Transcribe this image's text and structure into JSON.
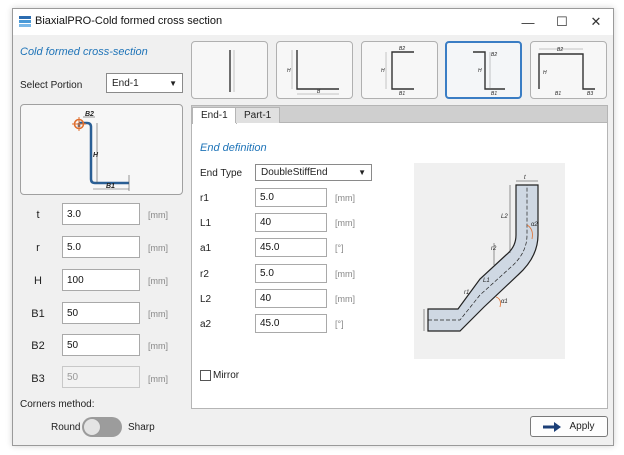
{
  "window": {
    "title": "BiaxialPRO-Cold formed cross section",
    "min_glyph": "—",
    "max_glyph": "☐",
    "close_glyph": "✕"
  },
  "left": {
    "section_title": "Cold formed cross-section",
    "select_label": "Select Portion",
    "portion_value": "End-1",
    "params": [
      {
        "label": "t",
        "value": "3.0",
        "unit": "[mm]"
      },
      {
        "label": "r",
        "value": "5.0",
        "unit": "[mm]"
      },
      {
        "label": "H",
        "value": "100",
        "unit": "[mm]"
      },
      {
        "label": "B1",
        "value": "50",
        "unit": "[mm]"
      },
      {
        "label": "B2",
        "value": "50",
        "unit": "[mm]"
      },
      {
        "label": "B3",
        "value": "50",
        "unit": "[mm]"
      }
    ],
    "corners_label": "Corners method:",
    "round_label": "Round",
    "sharp_label": "Sharp",
    "preview_labels": {
      "b2": "B2",
      "h": "H",
      "b1": "B1"
    }
  },
  "thumbs": {
    "t2_h": "H",
    "t2_b": "B",
    "t3_h": "H",
    "t3_b2": "B2",
    "t3_b1": "B1",
    "t4_h": "H",
    "t4_b2": "B2",
    "t4_b1": "B1",
    "t5_b2": "B2",
    "t5_h": "H",
    "t5_b1": "B1",
    "t5_b3": "B3"
  },
  "tabs": [
    {
      "label": "End-1"
    },
    {
      "label": "Part-1"
    }
  ],
  "end_def": {
    "title": "End definition",
    "end_type_label": "End Type",
    "end_type_value": "DoubleStiffEnd",
    "fields": [
      {
        "label": "r1",
        "value": "5.0",
        "unit": "[mm]"
      },
      {
        "label": "L1",
        "value": "40",
        "unit": "[mm]"
      },
      {
        "label": "a1",
        "value": "45.0",
        "unit": "[°]"
      },
      {
        "label": "r2",
        "value": "5.0",
        "unit": "[mm]"
      },
      {
        "label": "L2",
        "value": "40",
        "unit": "[mm]"
      },
      {
        "label": "a2",
        "value": "45.0",
        "unit": "[°]"
      }
    ],
    "mirror_label": "Mirror",
    "diagram_labels": {
      "l2": "L2",
      "a2": "α2",
      "r2": "r2",
      "r1": "r1",
      "l1": "L1",
      "a1": "α1",
      "t": "t"
    }
  },
  "apply_label": "Apply",
  "colors": {
    "accent": "#1f74b8",
    "section": "#9fb8d0",
    "section_fill": "#cfd8e3",
    "active_border": "#3a7dc4"
  }
}
